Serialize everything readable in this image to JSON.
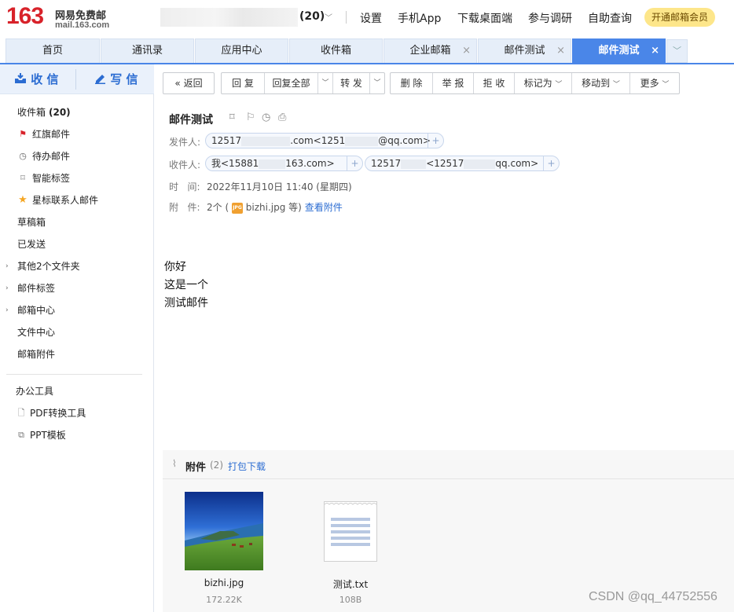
{
  "logo": {
    "number": "163",
    "title": "网易免费邮",
    "domain": "mail.163.com"
  },
  "topbar": {
    "unread": "(20)",
    "links": [
      "设置",
      "手机App",
      "下载桌面端",
      "参与调研",
      "自助查询"
    ],
    "vip": "开通邮箱会员"
  },
  "tabs": [
    {
      "label": "首页",
      "closable": false
    },
    {
      "label": "通讯录",
      "closable": false
    },
    {
      "label": "应用中心",
      "closable": false
    },
    {
      "label": "收件箱",
      "closable": false
    },
    {
      "label": "企业邮箱",
      "closable": true
    },
    {
      "label": "邮件测试",
      "closable": true
    },
    {
      "label": "邮件测试",
      "closable": true,
      "active": true
    }
  ],
  "sidebar": {
    "receive": "收 信",
    "write": "写 信",
    "items": [
      "收件箱",
      "红旗邮件",
      "待办邮件",
      "智能标签",
      "星标联系人邮件",
      "草稿箱",
      "已发送",
      "其他2个文件夹",
      "邮件标签",
      "邮箱中心",
      "文件中心",
      "邮箱附件"
    ],
    "inbox_count": "(20)",
    "tools_title": "办公工具",
    "tools": [
      "PDF转换工具",
      "PPT模板"
    ]
  },
  "toolbar": {
    "back": "返回",
    "reply": "回 复",
    "reply_all": "回复全部",
    "forward": "转 发",
    "delete": "删 除",
    "report": "举 报",
    "reject": "拒 收",
    "mark_as": "标记为",
    "move_to": "移动到",
    "more": "更多"
  },
  "mail": {
    "subject": "邮件测试",
    "from_label": "发件人:",
    "from_name_start": "12517",
    "from_name_end": ".com",
    "from_addr_start": "<1251",
    "from_addr_end": "@qq.com>",
    "to_label": "收件人:",
    "to1_start": "我<15881",
    "to1_end": "163.com>",
    "to2_start": "12517",
    "to2_mid": "<12517",
    "to2_end": "qq.com>",
    "time_label": "时   间:",
    "time": "2022年11月10日 11:40 (星期四)",
    "att_label": "附   件:",
    "att_count_prefix": "2个 (",
    "att_file": "bizhi.jpg 等)",
    "view_att": "查看附件",
    "body": [
      "你好",
      "这是一个",
      "测试邮件"
    ]
  },
  "attachments": {
    "title": "附件",
    "count": "(2)",
    "download_all": "打包下载",
    "files": [
      {
        "name": "bizhi.jpg",
        "size": "172.22K"
      },
      {
        "name": "测试.txt",
        "size": "108B"
      }
    ]
  },
  "watermark": "CSDN @qq_44752556"
}
